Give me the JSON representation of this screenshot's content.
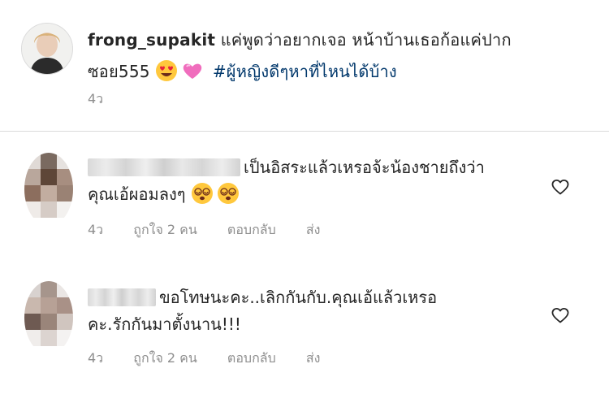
{
  "caption": {
    "username": "frong_supakit",
    "text_line1": "แค่พูดว่าอยากเจอ หน้าบ้านเธอก้อแค่ปาก",
    "text_line2_prefix": "ซอย555",
    "emoji_1": "heart-eyes-emoji",
    "emoji_2": "pink-heart-emoji",
    "hashtag": "#ผู้หญิงดีๆหาที่ไหนได้บ้าง",
    "time": "4ว"
  },
  "comments": [
    {
      "text_line1": "เป็นอิสระแล้วเหรอจ้ะน้องชายถึงว่า",
      "text_line2": "คุณเอ้ผอมลงๆ",
      "emoji": "dizzy-face-emoji",
      "time": "4ว",
      "likes": "ถูกใจ 2 คน",
      "reply": "ตอบกลับ",
      "send": "ส่ง"
    },
    {
      "text_line1": "ขอโทษนะคะ..เลิกกันกับ.คุณเอ้แล้วเหรอ",
      "text_line2": "คะ.รักกันมาตั้งนาน!!!",
      "time": "4ว",
      "likes": "ถูกใจ 2 คน",
      "reply": "ตอบกลับ",
      "send": "ส่ง"
    }
  ],
  "colors": {
    "text": "#262626",
    "muted": "#8e8e8e",
    "hashtag": "#00376b",
    "divider": "#dbdbdb"
  }
}
